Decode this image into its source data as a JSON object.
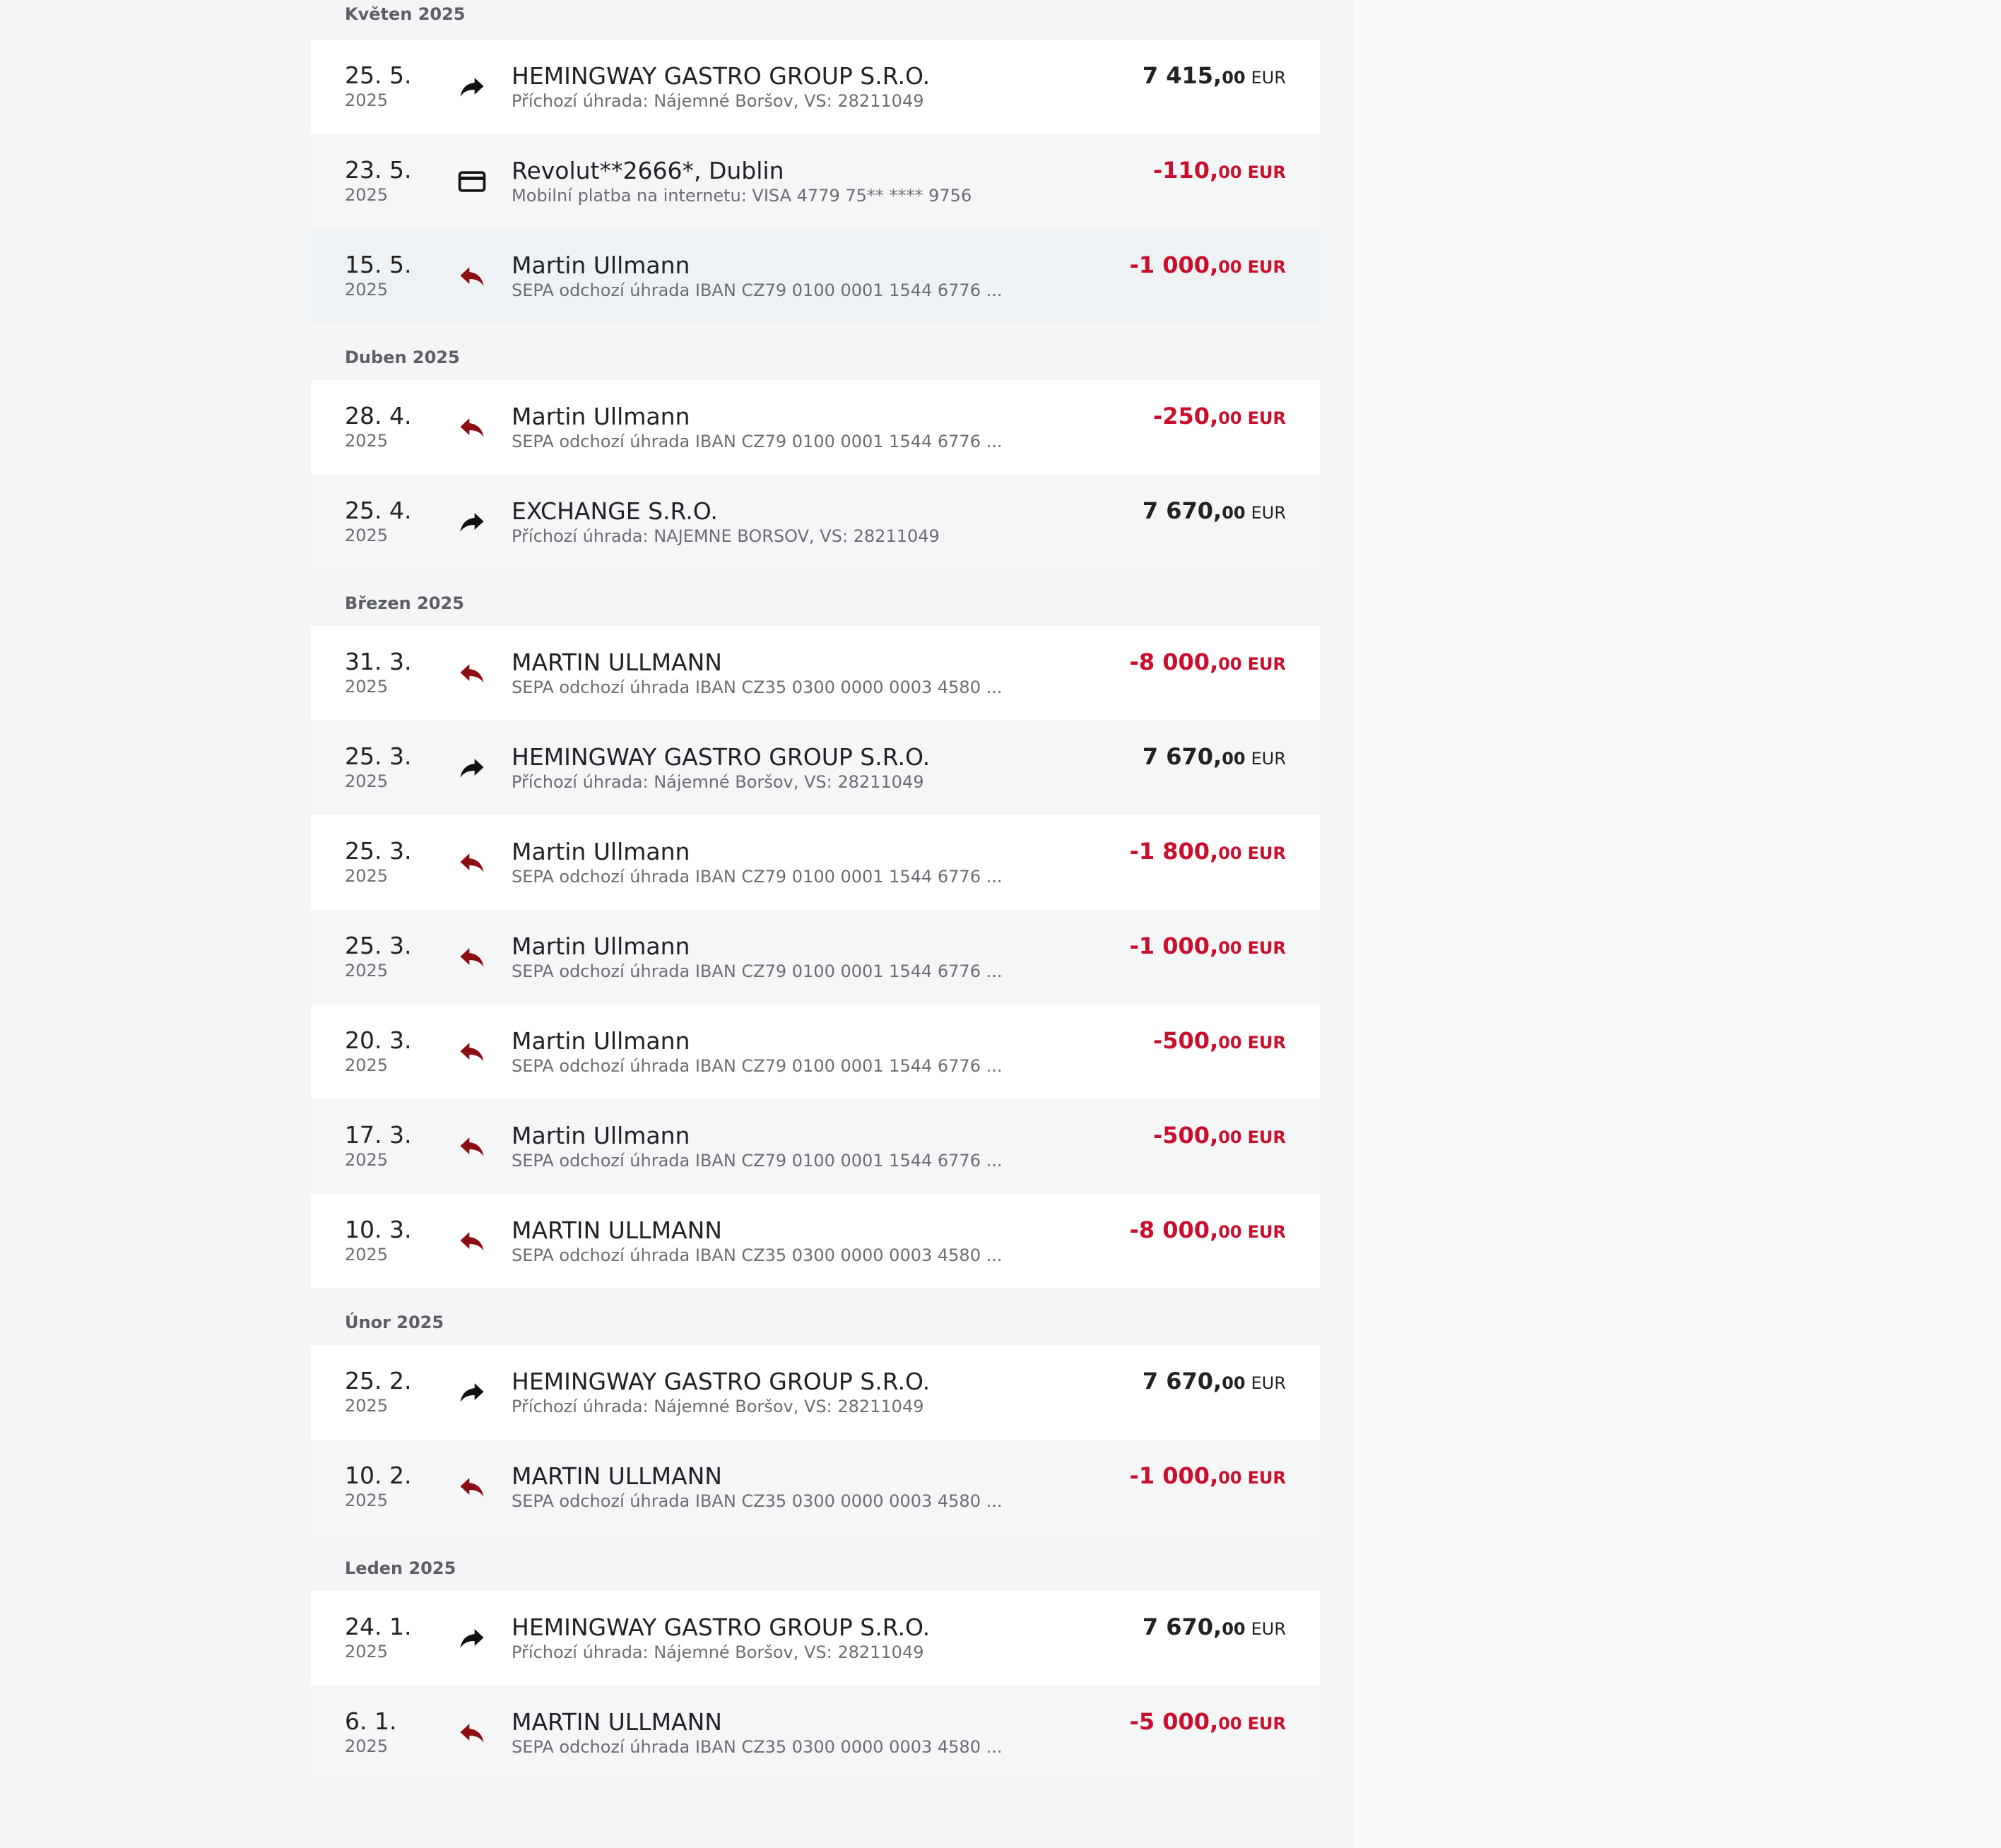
{
  "months": [
    {
      "label": "Květen 2025",
      "rows": [
        {
          "day": "25. 5.",
          "year": "2025",
          "icon": "arrow-incoming-icon",
          "name": "HEMINGWAY GASTRO GROUP S.R.O.",
          "detail": "Příchozí úhrada: Nájemné Boršov, VS: 28211049",
          "amount_main": "7 415,",
          "amount_dec": "00",
          "currency": "EUR",
          "sign": "pos"
        },
        {
          "day": "23. 5.",
          "year": "2025",
          "icon": "card-icon",
          "name": "Revolut**2666*, Dublin",
          "detail": "Mobilní platba na internetu: VISA 4779 75** **** 9756",
          "amount_main": "-110,",
          "amount_dec": "00",
          "currency": "EUR",
          "sign": "neg"
        },
        {
          "day": "15. 5.",
          "year": "2025",
          "icon": "arrow-outgoing-icon",
          "name": "Martin Ullmann",
          "detail": "SEPA odchozí úhrada IBAN  CZ79 0100 0001 1544 6776 ...",
          "amount_main": "-1 000,",
          "amount_dec": "00",
          "currency": "EUR",
          "sign": "neg"
        }
      ]
    },
    {
      "label": "Duben 2025",
      "rows": [
        {
          "day": "28. 4.",
          "year": "2025",
          "icon": "arrow-outgoing-icon",
          "name": "Martin Ullmann",
          "detail": "SEPA odchozí úhrada IBAN  CZ79 0100 0001 1544 6776 ...",
          "amount_main": "-250,",
          "amount_dec": "00",
          "currency": "EUR",
          "sign": "neg"
        },
        {
          "day": "25. 4.",
          "year": "2025",
          "icon": "arrow-incoming-icon",
          "name": "EXCHANGE S.R.O.",
          "detail": "Příchozí úhrada: NAJEMNE BORSOV, VS: 28211049",
          "amount_main": "7 670,",
          "amount_dec": "00",
          "currency": "EUR",
          "sign": "pos"
        }
      ]
    },
    {
      "label": "Březen 2025",
      "rows": [
        {
          "day": "31. 3.",
          "year": "2025",
          "icon": "arrow-outgoing-icon",
          "name": "MARTIN ULLMANN",
          "detail": "SEPA odchozí úhrada IBAN  CZ35 0300 0000 0003 4580 ...",
          "amount_main": "-8 000,",
          "amount_dec": "00",
          "currency": "EUR",
          "sign": "neg"
        },
        {
          "day": "25. 3.",
          "year": "2025",
          "icon": "arrow-incoming-icon",
          "name": "HEMINGWAY GASTRO GROUP S.R.O.",
          "detail": "Příchozí úhrada: Nájemné Boršov, VS: 28211049",
          "amount_main": "7 670,",
          "amount_dec": "00",
          "currency": "EUR",
          "sign": "pos"
        },
        {
          "day": "25. 3.",
          "year": "2025",
          "icon": "arrow-outgoing-icon",
          "name": "Martin Ullmann",
          "detail": "SEPA odchozí úhrada IBAN  CZ79 0100 0001 1544 6776 ...",
          "amount_main": "-1 800,",
          "amount_dec": "00",
          "currency": "EUR",
          "sign": "neg"
        },
        {
          "day": "25. 3.",
          "year": "2025",
          "icon": "arrow-outgoing-icon",
          "name": "Martin Ullmann",
          "detail": "SEPA odchozí úhrada IBAN  CZ79 0100 0001 1544 6776 ...",
          "amount_main": "-1 000,",
          "amount_dec": "00",
          "currency": "EUR",
          "sign": "neg"
        },
        {
          "day": "20. 3.",
          "year": "2025",
          "icon": "arrow-outgoing-icon",
          "name": "Martin Ullmann",
          "detail": "SEPA odchozí úhrada IBAN  CZ79 0100 0001 1544 6776 ...",
          "amount_main": "-500,",
          "amount_dec": "00",
          "currency": "EUR",
          "sign": "neg"
        },
        {
          "day": "17. 3.",
          "year": "2025",
          "icon": "arrow-outgoing-icon",
          "name": "Martin Ullmann",
          "detail": "SEPA odchozí úhrada IBAN  CZ79 0100 0001 1544 6776 ...",
          "amount_main": "-500,",
          "amount_dec": "00",
          "currency": "EUR",
          "sign": "neg"
        },
        {
          "day": "10. 3.",
          "year": "2025",
          "icon": "arrow-outgoing-icon",
          "name": "MARTIN ULLMANN",
          "detail": "SEPA odchozí úhrada IBAN  CZ35 0300 0000 0003 4580 ...",
          "amount_main": "-8 000,",
          "amount_dec": "00",
          "currency": "EUR",
          "sign": "neg"
        }
      ]
    },
    {
      "label": "Únor 2025",
      "rows": [
        {
          "day": "25. 2.",
          "year": "2025",
          "icon": "arrow-incoming-icon",
          "name": "HEMINGWAY GASTRO GROUP S.R.O.",
          "detail": "Příchozí úhrada: Nájemné Boršov, VS: 28211049",
          "amount_main": "7 670,",
          "amount_dec": "00",
          "currency": "EUR",
          "sign": "pos"
        },
        {
          "day": "10. 2.",
          "year": "2025",
          "icon": "arrow-outgoing-icon",
          "name": "MARTIN ULLMANN",
          "detail": "SEPA odchozí úhrada IBAN  CZ35 0300 0000 0003 4580 ...",
          "amount_main": "-1 000,",
          "amount_dec": "00",
          "currency": "EUR",
          "sign": "neg"
        }
      ]
    },
    {
      "label": "Leden 2025",
      "rows": [
        {
          "day": "24. 1.",
          "year": "2025",
          "icon": "arrow-incoming-icon",
          "name": "HEMINGWAY GASTRO GROUP S.R.O.",
          "detail": "Příchozí úhrada: Nájemné Boršov, VS: 28211049",
          "amount_main": "7 670,",
          "amount_dec": "00",
          "currency": "EUR",
          "sign": "pos"
        },
        {
          "day": "6. 1.",
          "year": "2025",
          "icon": "arrow-outgoing-icon",
          "name": "MARTIN ULLMANN",
          "detail": "SEPA odchozí úhrada IBAN  CZ35 0300 0000 0003 4580 ...",
          "amount_main": "-5 000,",
          "amount_dec": "00",
          "currency": "EUR",
          "sign": "neg"
        }
      ]
    }
  ],
  "colors": {
    "negative": "#c8102e",
    "positive": "#222222",
    "outgoing_icon": "#8b0f12",
    "incoming_icon": "#111111"
  }
}
